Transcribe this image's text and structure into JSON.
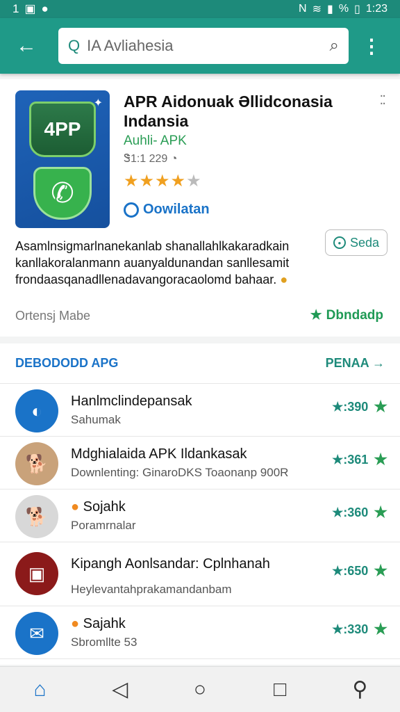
{
  "status_bar": {
    "left_text": "1",
    "time": "1:23",
    "battery": "%"
  },
  "search": {
    "lead": "Q",
    "query": "IA Avliahesia"
  },
  "app": {
    "title": "APR Aidonuak Əllidconasia Indansia",
    "subtitle": "Auhli- APK",
    "meta": "Ꮥ1:1 229",
    "rating": 4,
    "rating_max": 5,
    "download_label": "Oowilatan",
    "icon_text": "4PP",
    "description": "Asamlnsigmarlnanekanlab shanallahlkakaradkain kanllakoralanmann auanyaldunandan sanllesamit frondaasqanadllenadavangoracaolomd bahaar.",
    "see_label": "Seda",
    "footer_left": "Ortensj Mabe",
    "footer_right": "Dbndadp"
  },
  "list": {
    "title": "DEBODODD APG",
    "see_more": "PENAA →",
    "items": [
      {
        "title": "Hanlmclindepansak",
        "sub": "Sahumak",
        "rating": "★:390",
        "avatar_color": "#1a73c8",
        "avatar_glyph": "◐"
      },
      {
        "title": "Mdghialaida APK Ildankasak",
        "sub": "Downlenting: GinaroDKS Toaonanp 900R",
        "rating": "★:361",
        "avatar_color": "#c9a27a",
        "avatar_glyph": "🐕"
      },
      {
        "title": "Sojahk",
        "sub": "Poramrnalar",
        "rating": "★:360",
        "avatar_color": "#d8d8d8",
        "avatar_glyph": "🐕"
      },
      {
        "title": "Kipangh Aonlsandar: Cplnhanah",
        "sub": "Heylevantahprakamandanbam",
        "rating": "★:650",
        "avatar_color": "#8b1a1a",
        "avatar_glyph": "▣"
      },
      {
        "title": "Sajahk",
        "sub": "Sbromllte 53",
        "rating": "★:330",
        "avatar_color": "#1a73c8",
        "avatar_glyph": "✉"
      }
    ]
  }
}
